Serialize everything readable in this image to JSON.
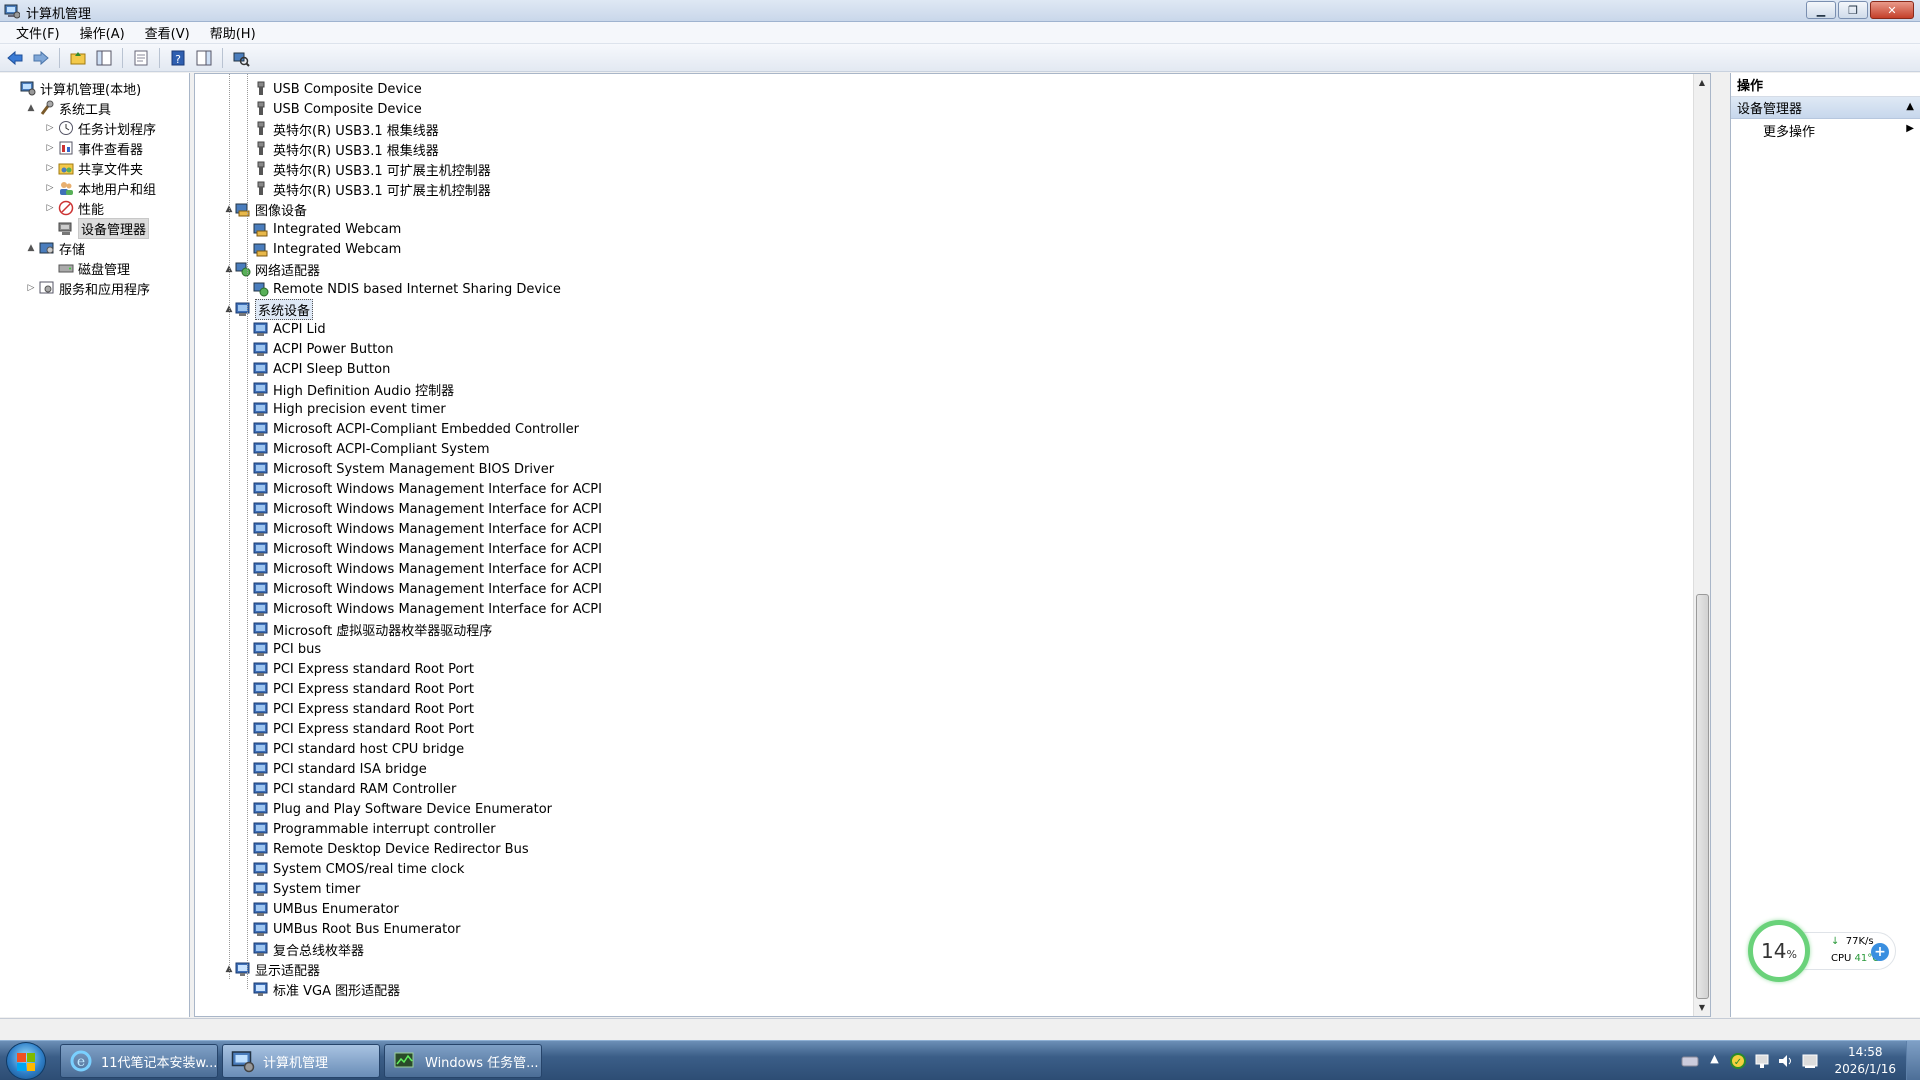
{
  "window": {
    "title": "计算机管理"
  },
  "menu": [
    "文件(F)",
    "操作(A)",
    "查看(V)",
    "帮助(H)"
  ],
  "left_tree": [
    {
      "label": "计算机管理(本地)",
      "level": 0,
      "arrow": "",
      "icon": "computer-management-icon"
    },
    {
      "label": "系统工具",
      "level": 1,
      "arrow": "▲",
      "icon": "tools-icon"
    },
    {
      "label": "任务计划程序",
      "level": 2,
      "arrow": "▷",
      "icon": "clock-icon"
    },
    {
      "label": "事件查看器",
      "level": 2,
      "arrow": "▷",
      "icon": "event-viewer-icon"
    },
    {
      "label": "共享文件夹",
      "level": 2,
      "arrow": "▷",
      "icon": "shared-folder-icon"
    },
    {
      "label": "本地用户和组",
      "level": 2,
      "arrow": "▷",
      "icon": "users-icon"
    },
    {
      "label": "性能",
      "level": 2,
      "arrow": "▷",
      "icon": "performance-icon"
    },
    {
      "label": "设备管理器",
      "level": 2,
      "arrow": "",
      "icon": "device-manager-icon",
      "selected": true
    },
    {
      "label": "存储",
      "level": 1,
      "arrow": "▲",
      "icon": "storage-icon"
    },
    {
      "label": "磁盘管理",
      "level": 2,
      "arrow": "",
      "icon": "disk-icon"
    },
    {
      "label": "服务和应用程序",
      "level": 1,
      "arrow": "▷",
      "icon": "services-icon"
    }
  ],
  "devices": [
    {
      "label": "USB Composite Device",
      "type": "usb",
      "level": 1
    },
    {
      "label": "USB Composite Device",
      "type": "usb",
      "level": 1
    },
    {
      "label": "英特尔(R) USB3.1 根集线器",
      "type": "usb",
      "level": 1
    },
    {
      "label": "英特尔(R) USB3.1 根集线器",
      "type": "usb",
      "level": 1
    },
    {
      "label": "英特尔(R) USB3.1 可扩展主机控制器",
      "type": "usb",
      "level": 1
    },
    {
      "label": "英特尔(R) USB3.1 可扩展主机控制器",
      "type": "usb",
      "level": 1
    },
    {
      "label": "图像设备",
      "type": "camera",
      "level": 0
    },
    {
      "label": "Integrated Webcam",
      "type": "camera",
      "level": 1
    },
    {
      "label": "Integrated Webcam",
      "type": "camera",
      "level": 1
    },
    {
      "label": "网络适配器",
      "type": "network",
      "level": 0
    },
    {
      "label": "Remote NDIS based Internet Sharing Device",
      "type": "network",
      "level": 1
    },
    {
      "label": "系统设备",
      "type": "system",
      "level": 0,
      "selected": true
    },
    {
      "label": "ACPI Lid",
      "type": "system",
      "level": 1
    },
    {
      "label": "ACPI Power Button",
      "type": "system",
      "level": 1
    },
    {
      "label": "ACPI Sleep Button",
      "type": "system",
      "level": 1
    },
    {
      "label": "High Definition Audio 控制器",
      "type": "system",
      "level": 1
    },
    {
      "label": "High precision event timer",
      "type": "system",
      "level": 1
    },
    {
      "label": "Microsoft ACPI-Compliant Embedded Controller",
      "type": "system",
      "level": 1
    },
    {
      "label": "Microsoft ACPI-Compliant System",
      "type": "system",
      "level": 1
    },
    {
      "label": "Microsoft System Management BIOS Driver",
      "type": "system",
      "level": 1
    },
    {
      "label": "Microsoft Windows Management Interface for ACPI",
      "type": "system",
      "level": 1
    },
    {
      "label": "Microsoft Windows Management Interface for ACPI",
      "type": "system",
      "level": 1
    },
    {
      "label": "Microsoft Windows Management Interface for ACPI",
      "type": "system",
      "level": 1
    },
    {
      "label": "Microsoft Windows Management Interface for ACPI",
      "type": "system",
      "level": 1
    },
    {
      "label": "Microsoft Windows Management Interface for ACPI",
      "type": "system",
      "level": 1
    },
    {
      "label": "Microsoft Windows Management Interface for ACPI",
      "type": "system",
      "level": 1
    },
    {
      "label": "Microsoft Windows Management Interface for ACPI",
      "type": "system",
      "level": 1
    },
    {
      "label": "Microsoft 虚拟驱动器枚举器驱动程序",
      "type": "system",
      "level": 1
    },
    {
      "label": "PCI bus",
      "type": "system",
      "level": 1
    },
    {
      "label": "PCI Express standard Root Port",
      "type": "system",
      "level": 1
    },
    {
      "label": "PCI Express standard Root Port",
      "type": "system",
      "level": 1
    },
    {
      "label": "PCI Express standard Root Port",
      "type": "system",
      "level": 1
    },
    {
      "label": "PCI Express standard Root Port",
      "type": "system",
      "level": 1
    },
    {
      "label": "PCI standard host CPU bridge",
      "type": "system",
      "level": 1
    },
    {
      "label": "PCI standard ISA bridge",
      "type": "system",
      "level": 1
    },
    {
      "label": "PCI standard RAM Controller",
      "type": "system",
      "level": 1
    },
    {
      "label": "Plug and Play Software Device Enumerator",
      "type": "system",
      "level": 1
    },
    {
      "label": "Programmable interrupt controller",
      "type": "system",
      "level": 1
    },
    {
      "label": "Remote Desktop Device Redirector Bus",
      "type": "system",
      "level": 1
    },
    {
      "label": "System CMOS/real time clock",
      "type": "system",
      "level": 1
    },
    {
      "label": "System timer",
      "type": "system",
      "level": 1
    },
    {
      "label": "UMBus Enumerator",
      "type": "system",
      "level": 1
    },
    {
      "label": "UMBus Root Bus Enumerator",
      "type": "system",
      "level": 1
    },
    {
      "label": "复合总线枚举器",
      "type": "system",
      "level": 1
    },
    {
      "label": "显示适配器",
      "type": "display",
      "level": 0
    },
    {
      "label": "标准 VGA 图形适配器",
      "type": "display",
      "level": 1
    }
  ],
  "actions": {
    "header": "操作",
    "section": "设备管理器",
    "item": "更多操作"
  },
  "gadget": {
    "cpu_percent": "14",
    "percent_sign": "%",
    "net_speed": "77K/s",
    "cpu_label": "CPU",
    "cpu_temp": "41°C"
  },
  "taskbar": {
    "tasks": [
      {
        "label": "11代笔记本安装w...",
        "icon": "ie-icon"
      },
      {
        "label": "计算机管理",
        "icon": "computer-management-icon",
        "active": true
      },
      {
        "label": "Windows 任务管...",
        "icon": "task-manager-icon"
      }
    ],
    "time": "14:58",
    "date": "2026/1/16"
  }
}
